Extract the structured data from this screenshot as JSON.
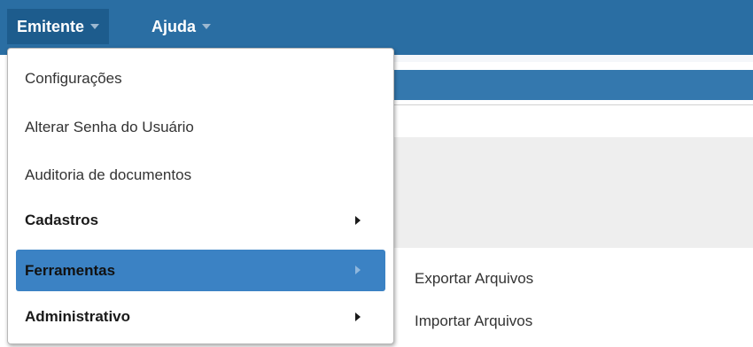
{
  "menubar": {
    "items": [
      {
        "label": "Emitente"
      },
      {
        "label": "Ajuda"
      }
    ]
  },
  "dropdown": {
    "items": [
      {
        "label": "Configurações"
      },
      {
        "label": "Alterar Senha do Usuário"
      },
      {
        "label": "Auditoria de documentos"
      },
      {
        "label": "Cadastros"
      },
      {
        "label": "Ferramentas"
      },
      {
        "label": "Administrativo"
      }
    ]
  },
  "submenu": {
    "items": [
      {
        "label": "Exportar Arquivos"
      },
      {
        "label": "Importar Arquivos"
      }
    ]
  },
  "colors": {
    "menubar_bg": "#2a6ea3",
    "active_menu_bg": "#1d5c8d",
    "selected_item_bg": "#3b82c4"
  }
}
